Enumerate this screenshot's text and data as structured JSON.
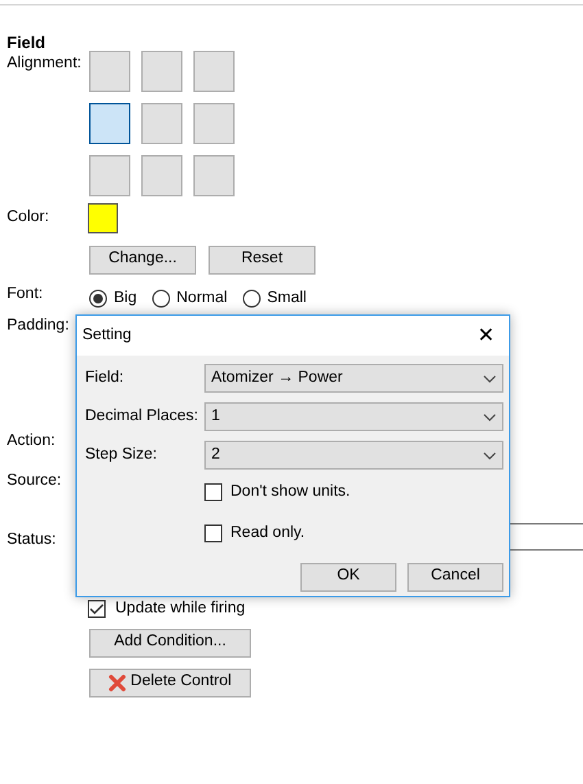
{
  "section_title": "Field",
  "alignment": {
    "label": "Alignment:",
    "cells": [
      {
        "selected": false
      },
      {
        "selected": false
      },
      {
        "selected": false
      },
      {
        "selected": true
      },
      {
        "selected": false
      },
      {
        "selected": false
      },
      {
        "selected": false
      },
      {
        "selected": false
      },
      {
        "selected": false
      }
    ]
  },
  "color": {
    "label": "Color:",
    "color": "#ffff00",
    "buttons": [
      "Change...",
      "Reset"
    ]
  },
  "font": {
    "label": "Font:",
    "options": [
      {
        "label": "Big",
        "selected": true
      },
      {
        "label": "Normal",
        "selected": false
      },
      {
        "label": "Small",
        "selected": false
      }
    ]
  },
  "padding": {
    "label": "Padding:"
  },
  "action": {
    "label": "Action:"
  },
  "source": {
    "label": "Source:"
  },
  "status": {
    "label": "Status:"
  },
  "update_while_firing": {
    "label": "Update while firing",
    "checked": true
  },
  "buttons": [
    {
      "label": "Add Condition...",
      "kind": "plain"
    },
    {
      "label": "Delete Control",
      "kind": "delete"
    }
  ],
  "dialog": {
    "title": "Setting",
    "close": "✕",
    "fields": [
      {
        "label": "Field:",
        "value": "Atomizer → Power"
      },
      {
        "label": "Decimal Places:",
        "value": "1"
      },
      {
        "label": "Step Size:",
        "value": "2"
      }
    ],
    "checkboxes": [
      {
        "label": "Don't show units.",
        "checked": false
      },
      {
        "label": "Read only.",
        "checked": false
      }
    ],
    "buttons": [
      "OK",
      "Cancel"
    ]
  }
}
